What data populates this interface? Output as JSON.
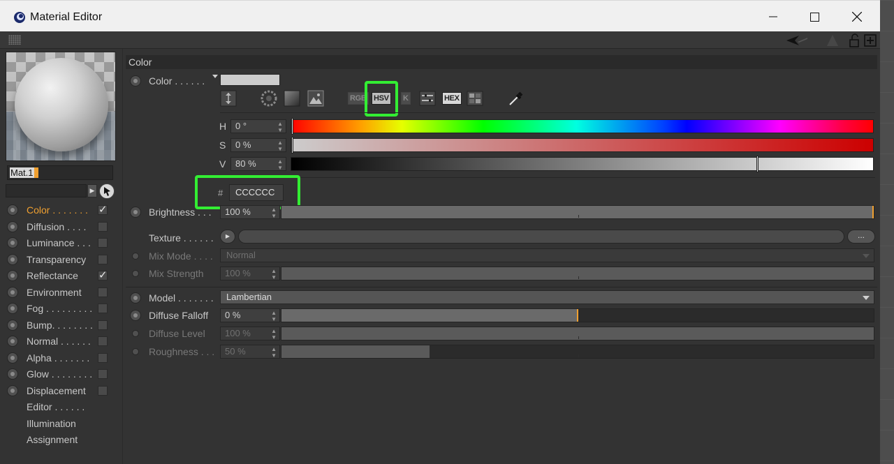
{
  "window": {
    "title": "Material Editor"
  },
  "material": {
    "name": "Mat.1"
  },
  "channels": [
    {
      "label": "Color . . . . . . .",
      "checked": true,
      "active": true
    },
    {
      "label": "Diffusion . . . .",
      "checked": false
    },
    {
      "label": "Luminance . . .",
      "checked": false
    },
    {
      "label": "Transparency",
      "checked": false
    },
    {
      "label": "Reflectance",
      "checked": true
    },
    {
      "label": "Environment",
      "checked": false
    },
    {
      "label": "Fog . . . . . . . . .",
      "checked": false
    },
    {
      "label": "Bump. . . . . . . .",
      "checked": false
    },
    {
      "label": "Normal . . . . . .",
      "checked": false
    },
    {
      "label": "Alpha . . . . . . .",
      "checked": false
    },
    {
      "label": "Glow . . . . . . . .",
      "checked": false
    },
    {
      "label": "Displacement",
      "checked": false
    }
  ],
  "extra_pages": [
    "Editor . . . . . .",
    "Illumination",
    "Assignment"
  ],
  "section": {
    "title": "Color"
  },
  "color": {
    "label": "Color . . . . . .",
    "swatch_hex": "#cccccc",
    "modes": [
      "RGB",
      "HSV",
      "K",
      "HEX"
    ],
    "active_mode": "HSV",
    "h_label": "H",
    "h_value": "0 °",
    "s_label": "S",
    "s_value": "0 %",
    "v_label": "V",
    "v_value": "80 %",
    "hue_fraction": 0.0,
    "sat_fraction": 0.0,
    "val_fraction": 0.8,
    "hash": "#",
    "hex_value": "CCCCCC"
  },
  "brightness": {
    "label": "Brightness . . .",
    "value": "100 %",
    "fraction": 1.0
  },
  "texture": {
    "label": "Texture . . . . . .",
    "more": "..."
  },
  "mix_mode": {
    "label": "Mix Mode . . . .",
    "value": "Normal"
  },
  "mix_strength": {
    "label": "Mix Strength",
    "value": "100 %",
    "fraction": 1.0
  },
  "model": {
    "label": "Model . . . . . . .",
    "value": "Lambertian"
  },
  "diffuse_falloff": {
    "label": "Diffuse Falloff",
    "value": "0 %",
    "fraction": 0.5
  },
  "diffuse_level": {
    "label": "Diffuse Level",
    "value": "100 %",
    "fraction": 1.0
  },
  "roughness": {
    "label": "Roughness . . .",
    "value": "50 %",
    "fraction": 0.25
  },
  "colors": {
    "accent": "#f0a030",
    "highlight": "#33ee33"
  },
  "icons": {
    "app": "cinema4d-icon",
    "minimize": "minimize-icon",
    "maximize": "maximize-icon",
    "close": "close-icon",
    "eyedropper": "eyedropper-icon"
  }
}
